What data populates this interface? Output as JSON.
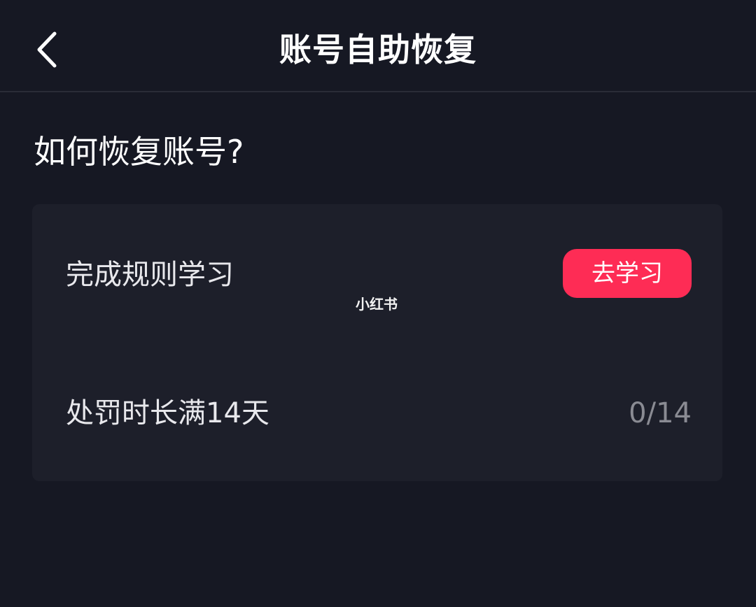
{
  "header": {
    "title": "账号自助恢复",
    "back_icon": "chevron-left-icon"
  },
  "section": {
    "title": "如何恢复账号?"
  },
  "card": {
    "rows": [
      {
        "label": "完成规则学习",
        "action_label": "去学习"
      },
      {
        "label": "处罚时长满14天",
        "progress_text": "0/14"
      }
    ]
  },
  "watermark": {
    "text": "小红书"
  },
  "colors": {
    "background": "#161823",
    "card": "#1d1f2a",
    "accent": "#fe2c55",
    "muted_text": "#8a8b93"
  }
}
